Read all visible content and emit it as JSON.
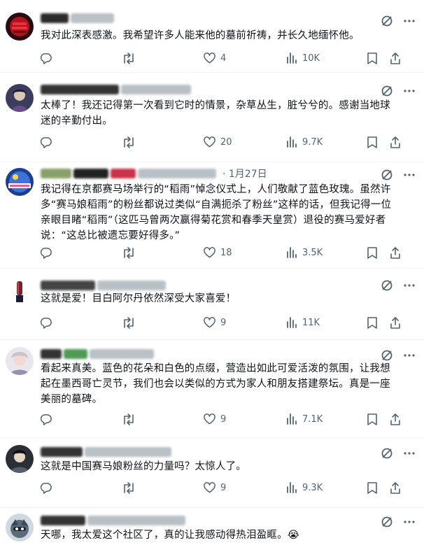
{
  "posts": [
    {
      "time": "",
      "text": "我对此深表感激。我希望许多人能来他的墓前祈祷，并长久地缅怀他。",
      "likes": "4",
      "views": "10K"
    },
    {
      "time": "",
      "text": "太棒了！我还记得第一次看到它时的情景，杂草丛生，脏兮兮的。感谢当地球迷的辛勤付出。",
      "likes": "20",
      "views": "9.7K"
    },
    {
      "time": "· 1月27日",
      "text": "我记得在京都赛马场举行的“稻雨”悼念仪式上，人们敬献了蓝色玫瑰。虽然许多“赛马娘稻雨”的粉丝都说过类似“自满扼杀了粉丝”这样的话，但我记得一位亲眼目睹“稻雨”（这匹马曾两次赢得菊花赏和春季天皇赏）退役的赛马爱好者说：“这总比被遗忘要好得多。”",
      "likes": "18",
      "views": "3.5K"
    },
    {
      "time": "",
      "text": "这就是爱！目白阿尔丹依然深受大家喜爱！",
      "likes": "9",
      "views": "11K"
    },
    {
      "time": "",
      "text": "看起来真美。蓝色的花朵和白色的点缀，营造出如此可爱活泼的氛围，让我想起在墨西哥亡灵节，我们也会以类似的方式为家人和朋友搭建祭坛。真是一座美丽的墓碑。",
      "likes": "9",
      "views": "7.1K"
    },
    {
      "time": "",
      "text": "这就是中国赛马娘粉丝的力量吗？太惊人了。",
      "likes": "9",
      "views": "9.3K"
    },
    {
      "time": "",
      "text": "天哪，我太爱这个社区了，真的让我感动得热泪盈眶。😭",
      "likes": "",
      "views": ""
    }
  ],
  "icons": {
    "reply": "reply-icon",
    "retweet": "retweet-icon",
    "like": "heart-icon",
    "views": "views-icon",
    "bookmark": "bookmark-icon",
    "share": "share-icon",
    "grok": "grok-icon",
    "more": "more-icon"
  },
  "colors": {
    "text": "#0f1419",
    "muted": "#536471",
    "divider": "#eff3f4"
  }
}
